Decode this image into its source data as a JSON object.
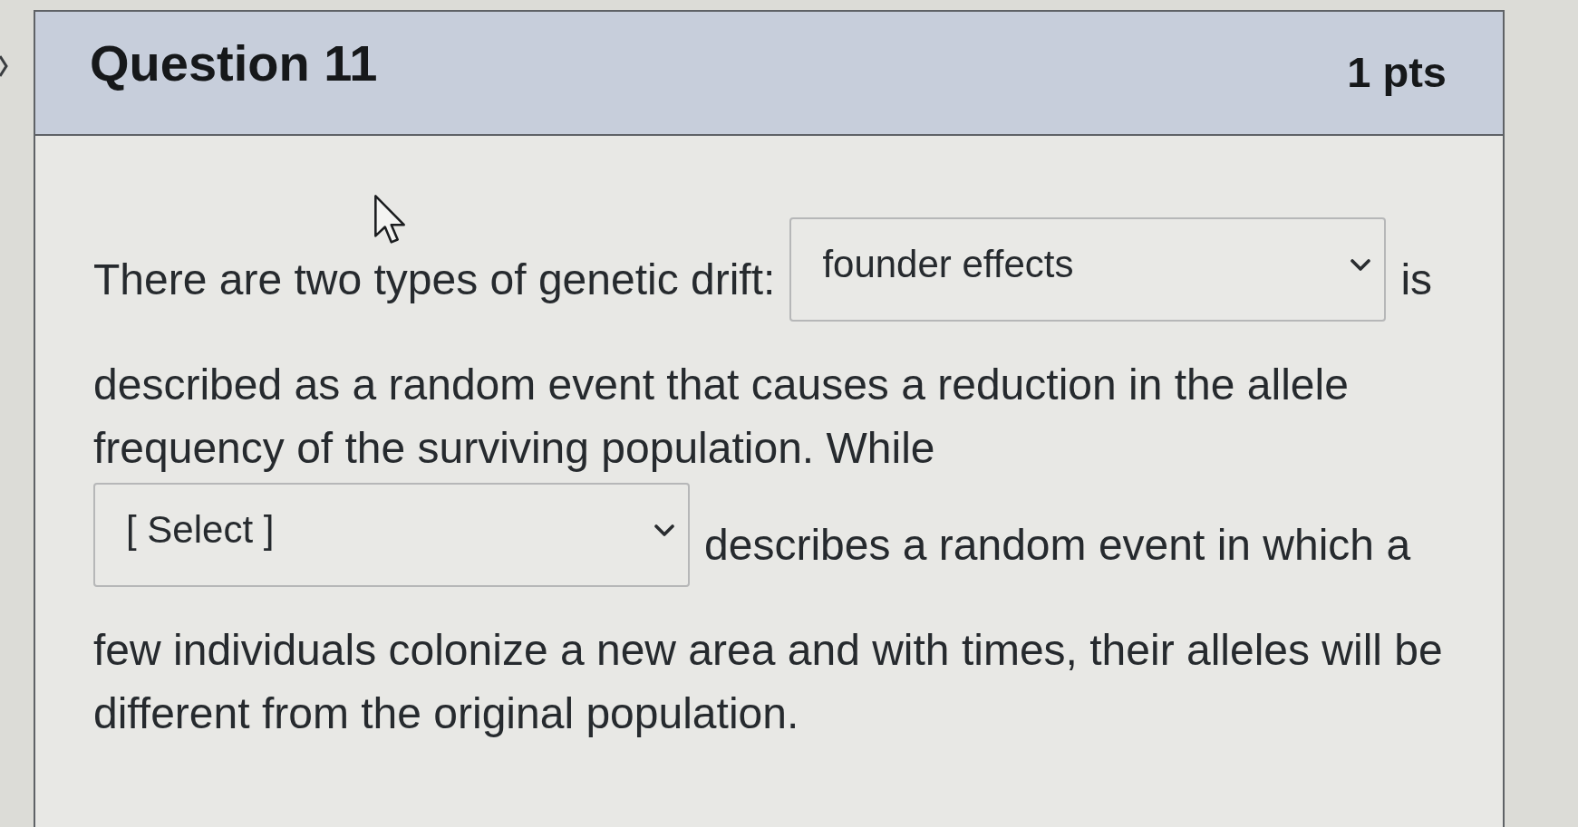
{
  "question": {
    "title": "Question 11",
    "points": "1 pts"
  },
  "body": {
    "rows": [
      [
        {
          "kind": "text",
          "text": "There are two types of genetic drift:"
        },
        {
          "kind": "dropdown",
          "value": "founder effects"
        },
        {
          "kind": "text",
          "text": "is"
        }
      ],
      [
        {
          "kind": "text",
          "text": "described as a random event that causes a reduction in the allele frequency of the surviving population. While"
        }
      ],
      [
        {
          "kind": "dropdown",
          "value": "[ Select ]"
        },
        {
          "kind": "text",
          "text": "describes a random event in which a"
        }
      ],
      [
        {
          "kind": "text",
          "text": "few individuals colonize a new area and with times, their alleles will be different from the original population."
        }
      ]
    ]
  }
}
